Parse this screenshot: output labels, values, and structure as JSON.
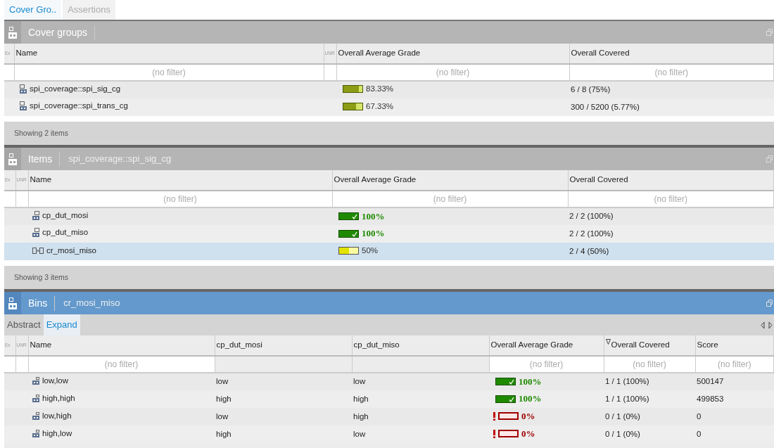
{
  "tabs": [
    {
      "label": "Cover Gro..",
      "selected": true
    },
    {
      "label": "Assertions",
      "selected": false
    }
  ],
  "panels": [
    {
      "title": "Cover groups",
      "active": false,
      "columns": [
        {
          "kind": "flag",
          "label": "Ex"
        },
        {
          "kind": "name",
          "label": "Name",
          "placeholder": "(no filter)"
        },
        {
          "kind": "flag",
          "label": "UNR"
        },
        {
          "kind": "grade",
          "label": "Overall Average Grade",
          "placeholder": "(no filter)"
        },
        {
          "kind": "text",
          "label": "Overall Covered",
          "placeholder": "(no filter)"
        }
      ],
      "rows": [
        {
          "selected": false,
          "cells": [
            "",
            {
              "kind": "covergroup",
              "text": "spi_coverage::spi_sig_cg"
            },
            "",
            {
              "kind": "high",
              "level": 0.8333,
              "text": "83.33%"
            },
            "6 / 8 (75%)"
          ]
        },
        {
          "selected": false,
          "cells": [
            "",
            {
              "kind": "covergroup",
              "text": "spi_coverage::spi_trans_cg"
            },
            "",
            {
              "kind": "high",
              "level": 0.6733,
              "text": "67.33%"
            },
            "300 / 5200 (5.77%)"
          ]
        }
      ],
      "footer": "Showing 2 items"
    },
    {
      "title": "Items",
      "subtitle": "spi_coverage::spi_sig_cg",
      "active": false,
      "columns": [
        {
          "kind": "flag",
          "label": "Ex"
        },
        {
          "kind": "flag",
          "label": "UNR"
        },
        {
          "kind": "name",
          "label": "Name",
          "placeholder": "(no filter)"
        },
        {
          "kind": "grade",
          "label": "Overall Average Grade",
          "placeholder": "(no filter)"
        },
        {
          "kind": "text",
          "label": "Overall Covered",
          "placeholder": "(no filter)"
        }
      ],
      "rows": [
        {
          "selected": false,
          "cells": [
            "",
            "",
            {
              "kind": "coverpoint",
              "text": "cp_dut_mosi"
            },
            {
              "kind": "complete",
              "level": 1,
              "text": "100%"
            },
            "2 / 2 (100%)"
          ]
        },
        {
          "selected": false,
          "cells": [
            "",
            "",
            {
              "kind": "coverpoint",
              "text": "cp_dut_miso"
            },
            {
              "kind": "complete",
              "level": 1,
              "text": "100%"
            },
            "2 / 2 (100%)"
          ]
        },
        {
          "selected": true,
          "cells": [
            "",
            "",
            {
              "kind": "cross",
              "text": "cr_mosi_miso"
            },
            {
              "kind": "medium",
              "level": 0.5,
              "text": "50%"
            },
            "2 / 4 (50%)"
          ]
        }
      ],
      "footer": "Showing 3 items"
    },
    {
      "title": "Bins",
      "subtitle": "cr_mosi_miso",
      "active": true,
      "subtabs": [
        {
          "label": "Abstract",
          "selected": false
        },
        {
          "label": "Expand",
          "selected": true
        }
      ],
      "columns": [
        {
          "kind": "flag",
          "label": "Ex"
        },
        {
          "kind": "flag",
          "label": "UNR"
        },
        {
          "kind": "name",
          "label": "Name",
          "placeholder": "(no filter)"
        },
        {
          "kind": "text",
          "label": "cp_dut_mosi"
        },
        {
          "kind": "text",
          "label": "cp_dut_miso"
        },
        {
          "kind": "grade",
          "label": "Overall Average Grade",
          "placeholder": "(no filter)"
        },
        {
          "kind": "text",
          "label": "Overall Covered",
          "placeholder": "(no filter)",
          "sorted": true
        },
        {
          "kind": "text",
          "label": "Score",
          "placeholder": "(no filter)"
        }
      ],
      "rows": [
        {
          "selected": false,
          "cells": [
            "",
            "",
            {
              "kind": "bin",
              "text": "low,low"
            },
            "low",
            "low",
            {
              "kind": "complete",
              "level": 1,
              "text": "100%"
            },
            "1 / 1 (100%)",
            "500147"
          ]
        },
        {
          "selected": false,
          "cells": [
            "",
            "",
            {
              "kind": "bin",
              "text": "high,high"
            },
            "high",
            "high",
            {
              "kind": "complete",
              "level": 1,
              "text": "100%"
            },
            "1 / 1 (100%)",
            "499853"
          ]
        },
        {
          "selected": false,
          "cells": [
            "",
            "",
            {
              "kind": "bin",
              "text": "low,high"
            },
            "low",
            "high",
            {
              "kind": "none",
              "level": 0,
              "text": "0%"
            },
            "0 / 1 (0%)",
            "0"
          ]
        },
        {
          "selected": false,
          "cells": [
            "",
            "",
            {
              "kind": "bin",
              "text": "high,low"
            },
            "high",
            "low",
            {
              "kind": "none",
              "level": 0,
              "text": "0%"
            },
            "0 / 1 (0%)",
            "0"
          ]
        }
      ]
    }
  ]
}
